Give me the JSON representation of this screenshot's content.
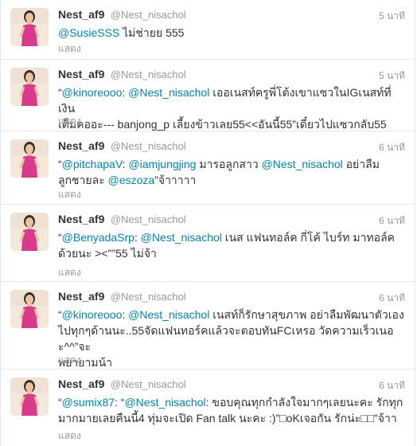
{
  "colors": {
    "link": "#0084b4",
    "muted": "#999999",
    "text": "#333333"
  },
  "tweets": [
    {
      "name": "Nest_af9",
      "handle": "@Nest_nisachol",
      "time": "5 นาที",
      "expand": "แสดง",
      "lines": [
        [
          {
            "t": "@SusieSSS",
            "m": true
          },
          {
            "t": " ไม่ช่ายย 555"
          }
        ]
      ]
    },
    {
      "name": "Nest_af9",
      "handle": "@Nest_nisachol",
      "time": "5 นาที",
      "expand": "แสดง",
      "lines": [
        [
          {
            "t": "“"
          },
          {
            "t": "@kinoreooo",
            "m": true
          },
          {
            "t": ": "
          },
          {
            "t": "@Nest_nisachol",
            "m": true
          },
          {
            "t": " เออเนสท์ครูพี่โต้งเขาแซวในIGเนสท์ที่เงิน"
          }
        ],
        [
          {
            "t": "เต็มคออะ--- banjong_p เลี้ยงข้าวเลย55<<อันนี้55”เดี๋ยวไปแซวกลับ55"
          }
        ]
      ]
    },
    {
      "name": "Nest_af9",
      "handle": "@Nest_nisachol",
      "time": "6 นาที",
      "expand": "แสดง",
      "lines": [
        [
          {
            "t": "“"
          },
          {
            "t": "@pitchapaV",
            "m": true
          },
          {
            "t": ": "
          },
          {
            "t": "@iamjungjing",
            "m": true
          },
          {
            "t": " มารอลูกสาว "
          },
          {
            "t": "@Nest_nisachol",
            "m": true
          },
          {
            "t": " อย่าลืม"
          }
        ],
        [
          {
            "t": "ลูกชายละ "
          },
          {
            "t": "@eszoza",
            "m": true
          },
          {
            "t": "”จ้าาาาา"
          }
        ]
      ]
    },
    {
      "name": "Nest_af9",
      "handle": "@Nest_nisachol",
      "time": "6 นาที",
      "expand": "แสดง",
      "lines": [
        [
          {
            "t": "“"
          },
          {
            "t": "@BenyadaSrp",
            "m": true
          },
          {
            "t": ": "
          },
          {
            "t": "@Nest_nisachol",
            "m": true
          },
          {
            "t": " เนส แฟนทอล์ค กี่โค้ ไบร์ท มาทอล์ค"
          }
        ],
        [
          {
            "t": "ด้วยนะ ><\"”55 ไม่จ้า"
          }
        ]
      ]
    },
    {
      "name": "Nest_af9",
      "handle": "@Nest_nisachol",
      "time": "6 นาที",
      "expand": "แสดง",
      "lines": [
        [
          {
            "t": "“"
          },
          {
            "t": "@kinoreooo",
            "m": true
          },
          {
            "t": ": "
          },
          {
            "t": "@Nest_nisachol",
            "m": true
          },
          {
            "t": " เนสท์ก็รักษาสุขภาพ อย่าลืมพัฒนาตัวเอง"
          }
        ],
        [
          {
            "t": "ไปทุกๆด้านนะ..55จัดแฟนทอร์คแล้วจะตอบทันFCเหรอ วัดความเร็วเนอะ^^”จะ"
          }
        ],
        [
          {
            "t": "พยายามน้า"
          }
        ]
      ]
    },
    {
      "name": "Nest_af9",
      "handle": "@Nest_nisachol",
      "time": "6 นาที",
      "expand": "แสดง",
      "lines": [
        [
          {
            "t": "“"
          },
          {
            "t": "@sumix87",
            "m": true
          },
          {
            "t": ": “"
          },
          {
            "t": "@Nest_nisachol",
            "m": true
          },
          {
            "t": ": ขอบคุณทุกกำลังใจมากๆเลยนะคะ รักทุก"
          }
        ],
        [
          {
            "t": "มากมายเลยคืนนี้4 ทุ่มจะเปิด Fan talk นะคะ :)”□oKเจอกัน รักน่ะ□□”จ้าา"
          }
        ]
      ]
    }
  ]
}
